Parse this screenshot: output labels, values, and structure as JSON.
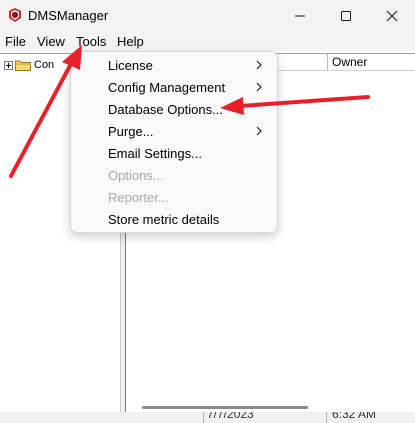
{
  "window": {
    "title": "DMSManager"
  },
  "menubar": {
    "items": [
      {
        "label": "File"
      },
      {
        "label": "View"
      },
      {
        "label": "Tools"
      },
      {
        "label": "Help"
      }
    ]
  },
  "tree": {
    "root_label": "Con"
  },
  "list": {
    "columns": [
      {
        "label": "Owner"
      }
    ]
  },
  "status": {
    "date": "7/7/2023",
    "time": "6:32 AM"
  },
  "tools_menu": {
    "items": [
      {
        "label": "License",
        "submenu": true,
        "enabled": true
      },
      {
        "label": "Config Management",
        "submenu": true,
        "enabled": true
      },
      {
        "label": "Database Options...",
        "submenu": false,
        "enabled": true
      },
      {
        "label": "Purge...",
        "submenu": true,
        "enabled": true
      },
      {
        "label": "Email Settings...",
        "submenu": false,
        "enabled": true
      },
      {
        "label": "Options...",
        "submenu": false,
        "enabled": false
      },
      {
        "label": "Reporter...",
        "submenu": false,
        "enabled": false
      },
      {
        "label": "Store metric details",
        "submenu": false,
        "enabled": true
      }
    ]
  },
  "icons": {
    "app": "app-icon",
    "minimize": "minimize-icon",
    "maximize": "maximize-icon",
    "close": "close-icon",
    "folder": "folder-icon",
    "expander": "tree-expand-icon",
    "submenu_arrow": "chevron-right-icon"
  },
  "colors": {
    "annotation": "#e8202a",
    "disabled_text": "#a7a7a7"
  }
}
